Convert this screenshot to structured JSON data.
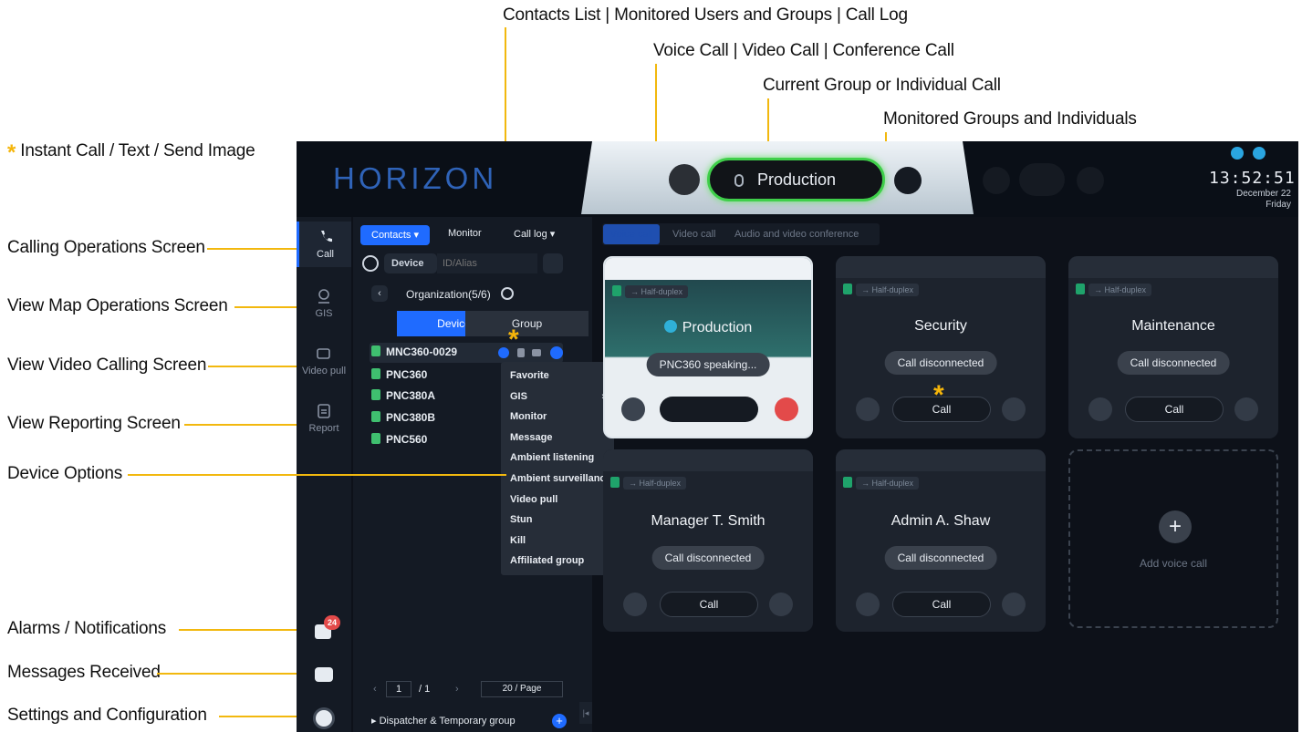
{
  "annotations": {
    "top": [
      "Contacts List | Monitored Users and Groups | Call Log",
      "Voice Call | Video Call | Conference Call",
      "Current Group or Individual Call",
      "Monitored Groups and Individuals"
    ],
    "left": [
      "Instant Call / Text / Send Image",
      "Calling Operations Screen",
      "View Map Operations Screen",
      "View Video Calling Screen",
      "View Reporting Screen",
      "Device Options",
      "Alarms / Notifications",
      "Messages Received",
      "Settings and Configuration"
    ],
    "star": "*"
  },
  "app": {
    "logo": "HORIZON",
    "current_call": "Production",
    "clock": {
      "time": "13:52:51",
      "date": "December 22",
      "day": "Friday"
    },
    "nav": [
      {
        "label": "Call",
        "icon": "phone-icon"
      },
      {
        "label": "GIS",
        "icon": "map-pin-icon"
      },
      {
        "label": "Video pull",
        "icon": "video-icon"
      },
      {
        "label": "Report",
        "icon": "clipboard-icon"
      }
    ],
    "alarm_count": "24",
    "panel": {
      "tabs": [
        "Contacts ▾",
        "Monitor",
        "Call log ▾"
      ],
      "device_filter": "Device",
      "search_placeholder": "ID/Alias",
      "org": "Organization(5/6)",
      "subtabs": [
        "Device",
        "Group"
      ],
      "devices": [
        "MNC360-0029",
        "PNC360",
        "PNC380A",
        "PNC380B",
        "PNC560"
      ],
      "pager": {
        "page": "1",
        "total": "/ 1",
        "per_page": "20 / Page"
      },
      "dispatcher": "Dispatcher & Temporary group"
    },
    "context_menu": [
      "Favorite",
      "GIS",
      "Monitor",
      "Message",
      "Ambient listening",
      "Ambient surveillance",
      "Video pull",
      "Stun",
      "Kill",
      "Affiliated group"
    ],
    "call_tabs": [
      "Voice call",
      "Video call",
      "Audio and video conference"
    ],
    "half_duplex": "→ Half-duplex",
    "cards": [
      {
        "name": "Production",
        "status": "PNC360 speaking...",
        "active": true
      },
      {
        "name": "Security",
        "status": "Call disconnected",
        "call": "Call"
      },
      {
        "name": "Maintenance",
        "status": "Call disconnected",
        "call": "Call"
      },
      {
        "name": "Manager T. Smith",
        "status": "Call disconnected",
        "call": "Call"
      },
      {
        "name": "Admin A. Shaw",
        "status": "Call disconnected",
        "call": "Call"
      }
    ],
    "add_voice_call": "Add voice call",
    "colors": {
      "accent": "#1f6bff",
      "annotation_line": "#f2b80e",
      "active_green": "#2ea84a",
      "end_red": "#e34a4a"
    }
  }
}
